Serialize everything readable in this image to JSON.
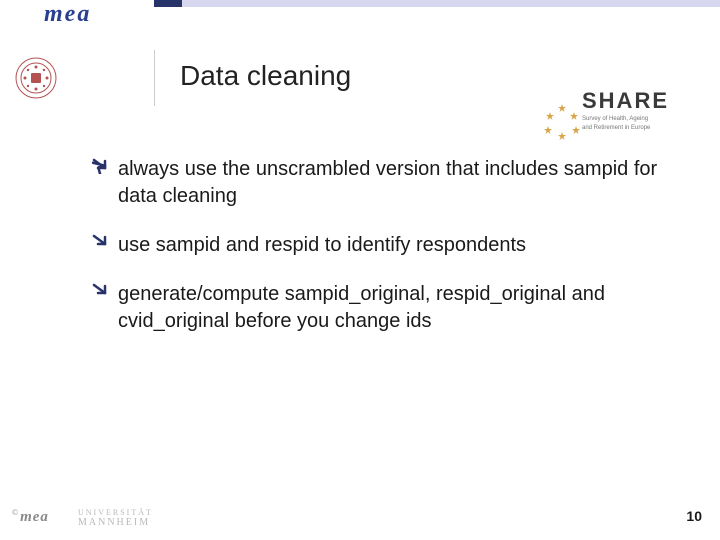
{
  "header": {
    "logo_text": "mea"
  },
  "title": "Data cleaning",
  "share": {
    "word": "SHARE",
    "sub1": "Survey of Health, Ageing",
    "sub2": "and Retirement in Europe"
  },
  "bullets": [
    "always use the unscrambled version that includes sampid for data cleaning",
    "use sampid and respid to identify respondents",
    "generate/compute sampid_original, respid_original and cvid_original before you change ids"
  ],
  "footer": {
    "copy": "©",
    "mea": "mea",
    "uni_top": "UNIVERSITÄT",
    "uni_bot": "MANNHEIM",
    "page": "10"
  }
}
